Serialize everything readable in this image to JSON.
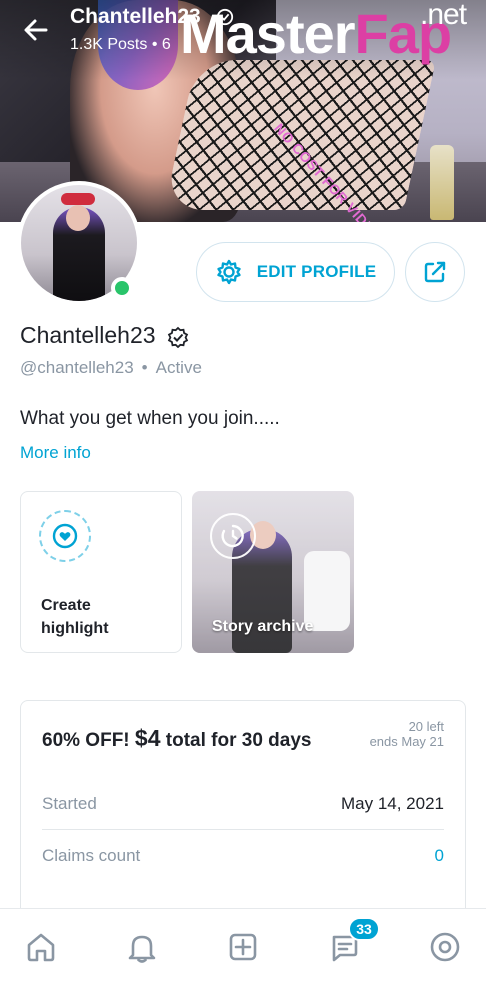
{
  "header": {
    "name": "Chantelleh23",
    "stats": "1.3K Posts • 6"
  },
  "watermark": {
    "main": "Master",
    "accent": "Fap",
    "suffix": ".net"
  },
  "cover": {
    "overlay_text": "NO COST FOR VIDEOS"
  },
  "actions": {
    "edit_profile": "EDIT PROFILE"
  },
  "profile": {
    "display_name": "Chantelleh23",
    "handle": "@chantelleh23",
    "separator": "•",
    "status": "Active",
    "bio": "What you get when you join.....",
    "more_info": "More info",
    "online_color": "#29c46a"
  },
  "highlights": [
    {
      "label": "Create highlight",
      "icon": "heart-circle-icon"
    },
    {
      "label": "Story archive",
      "icon": "clock-circle-icon"
    }
  ],
  "offer": {
    "prefix": "60% OFF!",
    "price": "$4",
    "suffix": "total for 30 days",
    "left_count": "20 left",
    "ends": "ends May 21",
    "rows": [
      {
        "label": "Started",
        "value": "May 14, 2021"
      },
      {
        "label": "Claims count",
        "value": "0"
      }
    ]
  },
  "nav": {
    "items": [
      "home-icon",
      "bell-icon",
      "plus-square-icon",
      "message-icon",
      "profile-icon"
    ],
    "messages_badge": "33"
  },
  "colors": {
    "accent": "#00a3d3",
    "text": "#1f2229",
    "muted": "#8a96a3",
    "watermark_accent": "#dc3fa4"
  }
}
